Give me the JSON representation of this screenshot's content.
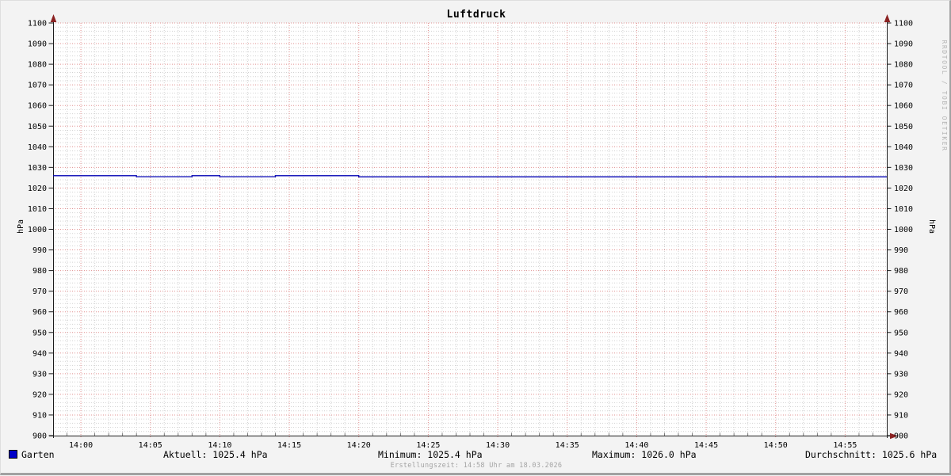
{
  "title": "Luftdruck",
  "watermark": "RRDTOOL / TOBI OETIKER",
  "footer": "Erstellungszeit: 14:58 Uhr am 18.03.2026",
  "axis": {
    "ylabel_left": "hPa",
    "ylabel_right": "hPa"
  },
  "legend": {
    "series_label": "Garten",
    "series_color": "#0000c8",
    "stats": [
      {
        "name": "aktuell",
        "text": "Aktuell: 1025.4 hPa"
      },
      {
        "name": "minimum",
        "text": "Minimum: 1025.4 hPa"
      },
      {
        "name": "maximum",
        "text": "Maximum: 1026.0 hPa"
      },
      {
        "name": "durchschnitt",
        "text": "Durchschnitt: 1025.6 hPa"
      }
    ]
  },
  "chart_data": {
    "type": "line",
    "title": "Luftdruck",
    "ylabel": "hPa",
    "ylim": [
      900,
      1100
    ],
    "y_major_step": 10,
    "y_minor_step": 2,
    "y_tick_labels": [
      900,
      910,
      920,
      930,
      940,
      950,
      960,
      970,
      980,
      990,
      1000,
      1010,
      1020,
      1030,
      1040,
      1050,
      1060,
      1070,
      1080,
      1090,
      1100
    ],
    "x_start": "13:58",
    "x_end": "14:58",
    "x_major_step_min": 5,
    "x_minor_step_min": 1,
    "x_tick_labels": [
      "14:00",
      "14:05",
      "14:10",
      "14:15",
      "14:20",
      "14:25",
      "14:30",
      "14:35",
      "14:40",
      "14:45",
      "14:50",
      "14:55"
    ],
    "grid": true,
    "legend_position": "bottom",
    "colors": {
      "background": "#f3f3f3",
      "canvas": "#ffffff",
      "major_grid": "#e09090",
      "minor_grid": "#d2d2d2",
      "axis": "#1c1c1c",
      "arrow": "#8b2222",
      "tick": "#666666",
      "line": "#0000b4"
    },
    "series": [
      {
        "name": "Garten",
        "color": "#0000b4",
        "points": [
          [
            "13:58",
            1026.0
          ],
          [
            "14:04",
            1026.0
          ],
          [
            "14:04",
            1025.5
          ],
          [
            "14:08",
            1025.5
          ],
          [
            "14:08",
            1026.0
          ],
          [
            "14:10",
            1026.0
          ],
          [
            "14:10",
            1025.5
          ],
          [
            "14:14",
            1025.5
          ],
          [
            "14:14",
            1026.0
          ],
          [
            "14:20",
            1026.0
          ],
          [
            "14:20",
            1025.4
          ],
          [
            "14:58",
            1025.4
          ]
        ]
      }
    ],
    "stats_summary": {
      "aktuell_hpa": 1025.4,
      "minimum_hpa": 1025.4,
      "maximum_hpa": 1026.0,
      "durchschnitt_hpa": 1025.6
    }
  }
}
